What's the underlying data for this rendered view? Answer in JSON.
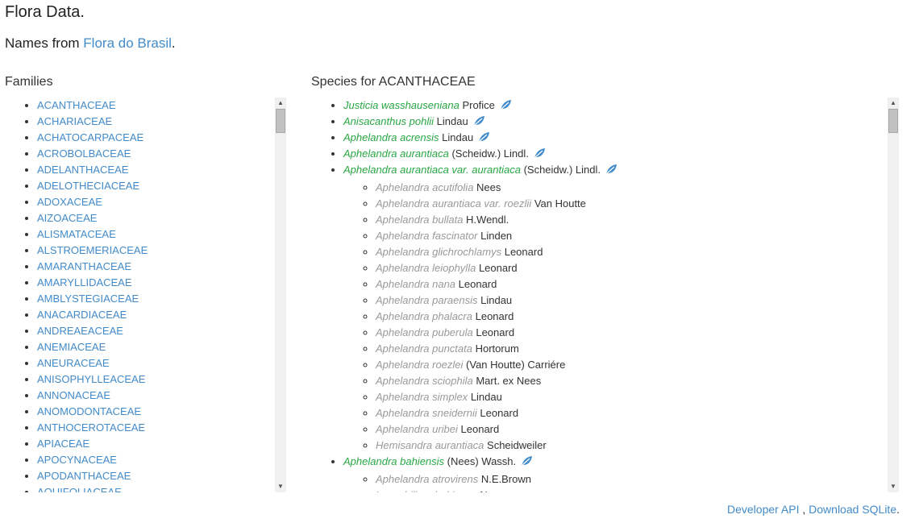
{
  "header": {
    "title": "Flora Data.",
    "subtitle_prefix": "Names from ",
    "subtitle_link": "Flora do Brasil",
    "subtitle_suffix": "."
  },
  "families": {
    "heading": "Families",
    "items": [
      "ACANTHACEAE",
      "ACHARIACEAE",
      "ACHATOCARPACEAE",
      "ACROBOLBACEAE",
      "ADELANTHACEAE",
      "ADELOTHECIACEAE",
      "ADOXACEAE",
      "AIZOACEAE",
      "ALISMATACEAE",
      "ALSTROEMERIACEAE",
      "AMARANTHACEAE",
      "AMARYLLIDACEAE",
      "AMBLYSTEGIACEAE",
      "ANACARDIACEAE",
      "ANDREAEACEAE",
      "ANEMIACEAE",
      "ANEURACEAE",
      "ANISOPHYLLEACEAE",
      "ANNONACEAE",
      "ANOMODONTACEAE",
      "ANTHOCEROTACEAE",
      "APIACEAE",
      "APOCYNACEAE",
      "APODANTHACEAE",
      "AQUIFOLIACEAE"
    ]
  },
  "species": {
    "heading": "Species for ACANTHACEAE",
    "items": [
      {
        "name": "Justicia wasshauseniana",
        "author": "Profice",
        "icon": "leaf-icon",
        "synonyms": []
      },
      {
        "name": "Anisacanthus pohlii",
        "author": "Lindau",
        "icon": "leaf-icon",
        "synonyms": []
      },
      {
        "name": "Aphelandra acrensis",
        "author": "Lindau",
        "icon": "leaf-icon",
        "synonyms": []
      },
      {
        "name": "Aphelandra aurantiaca",
        "author": "(Scheidw.) Lindl.",
        "icon": "leaf-icon",
        "synonyms": []
      },
      {
        "name": "Aphelandra aurantiaca var. aurantiaca",
        "author": "(Scheidw.) Lindl.",
        "icon": "leaf-icon",
        "synonyms": [
          {
            "name": "Aphelandra acutifolia",
            "author": "Nees"
          },
          {
            "name": "Aphelandra aurantiaca var. roezlii",
            "author": "Van Houtte"
          },
          {
            "name": "Aphelandra bullata",
            "author": "H.Wendl."
          },
          {
            "name": "Aphelandra fascinator",
            "author": "Linden"
          },
          {
            "name": "Aphelandra glichrochlamys",
            "author": "Leonard"
          },
          {
            "name": "Aphelandra leiophylla",
            "author": "Leonard"
          },
          {
            "name": "Aphelandra nana",
            "author": "Leonard"
          },
          {
            "name": "Aphelandra paraensis",
            "author": "Lindau"
          },
          {
            "name": "Aphelandra phalacra",
            "author": "Leonard"
          },
          {
            "name": "Aphelandra puberula",
            "author": "Leonard"
          },
          {
            "name": "Aphelandra punctata",
            "author": "Hortorum"
          },
          {
            "name": "Aphelandra roezlei",
            "author": "(Van Houtte) Carriére"
          },
          {
            "name": "Aphelandra sciophila",
            "author": "Mart. ex Nees"
          },
          {
            "name": "Aphelandra simplex",
            "author": "Lindau"
          },
          {
            "name": "Aphelandra sneidernii",
            "author": "Leonard"
          },
          {
            "name": "Aphelandra uribei",
            "author": "Leonard"
          },
          {
            "name": "Hemisandra aurantiaca",
            "author": "Scheidweiler"
          }
        ]
      },
      {
        "name": "Aphelandra bahiensis",
        "author": "(Nees) Wassh.",
        "icon": "leaf-icon",
        "synonyms": [
          {
            "name": "Aphelandra atrovirens",
            "author": "N.E.Brown"
          },
          {
            "name": "Lagochilium bahiense",
            "author": "Nees"
          }
        ]
      }
    ]
  },
  "footer": {
    "api_link": "Developer API",
    "separator": " , ",
    "download_link": "Download SQLite",
    "end": "."
  },
  "colors": {
    "link": "#428bca",
    "accepted_name": "#28a745",
    "synonym_name": "#999999",
    "leaf_icon": "#428bca"
  }
}
